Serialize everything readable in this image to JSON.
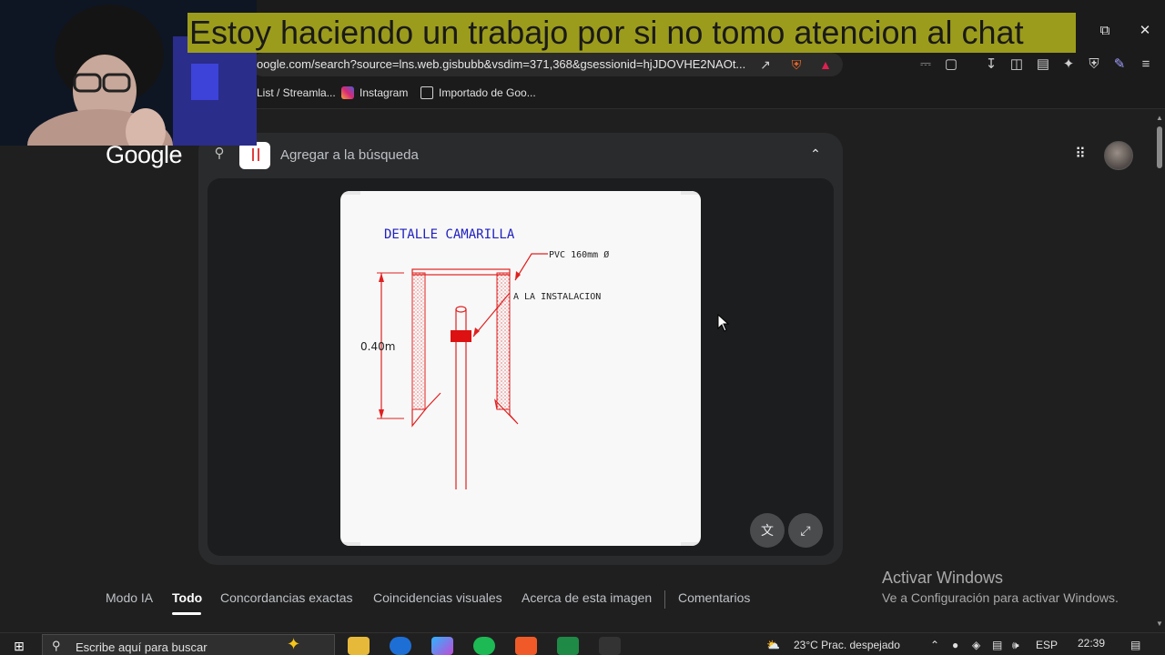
{
  "caption": "Estoy haciendo un trabajo por si no tomo atencion al chat",
  "browser": {
    "url": "oogle.com/search?source=lns.web.gisbubb&vsdim=371,368&gsessionid=hjJDOVHE2NAOt...",
    "bookmarks": [
      "List / Streamla...",
      "Instagram",
      "Importado de Goo..."
    ]
  },
  "google": {
    "logo": "Google",
    "search_placeholder": "Agregar a la búsqueda"
  },
  "drawing": {
    "title": "DETALLE  CAMARILLA",
    "pvc_label": "PVC 160mm Ø",
    "install_label": "A LA INSTALACION",
    "height_label": "0.40m"
  },
  "nav_tabs": [
    "Modo IA",
    "Todo",
    "Concordancias exactas",
    "Coincidencias visuales",
    "Acerca de esta imagen",
    "Comentarios"
  ],
  "active_tab": "Todo",
  "activate_windows": {
    "title": "Activar Windows",
    "subtitle": "Ve a Configuración para activar Windows."
  },
  "taskbar": {
    "search_placeholder": "Escribe aquí para buscar",
    "weather": "23°C  Prac. despejado",
    "lang": "ESP",
    "time": "22:39"
  },
  "colors": {
    "caption_bg": "#9c9c1c",
    "drawing_red": "#e02020",
    "drawing_blue": "#2020c0",
    "page_bg": "#1f1f1f",
    "panel_bg": "#2a2b2c"
  },
  "icons": [
    "search-icon",
    "share-icon",
    "brave-shield-icon",
    "extensions-icon",
    "download-icon",
    "sidebar-icon",
    "wallet-icon",
    "leo-icon",
    "vpn-icon",
    "apps-grid-icon",
    "translate-icon",
    "fullscreen-icon",
    "windows-start-icon"
  ]
}
